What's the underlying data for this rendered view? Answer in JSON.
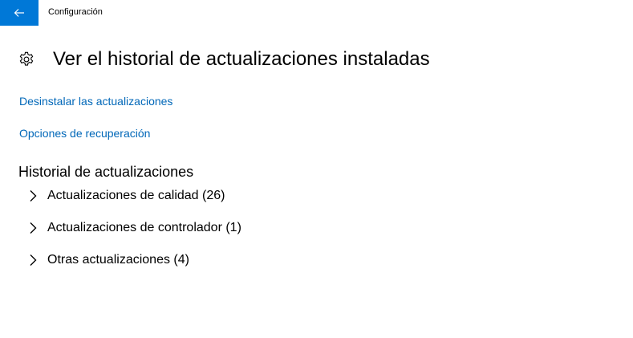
{
  "window": {
    "title": "Configuración",
    "back_icon": "back-arrow-icon",
    "accent_color": "#0078d7"
  },
  "header": {
    "icon": "gear-icon",
    "title": "Ver el historial de actualizaciones instaladas"
  },
  "links": {
    "uninstall": "Desinstalar las actualizaciones",
    "recovery": "Opciones de recuperación",
    "link_color": "#0067b8"
  },
  "history": {
    "title": "Historial de actualizaciones",
    "items": [
      {
        "label": "Actualizaciones de calidad (26)",
        "icon": "chevron-right-icon"
      },
      {
        "label": "Actualizaciones de controlador (1)",
        "icon": "chevron-right-icon"
      },
      {
        "label": "Otras actualizaciones (4)",
        "icon": "chevron-right-icon"
      }
    ]
  }
}
